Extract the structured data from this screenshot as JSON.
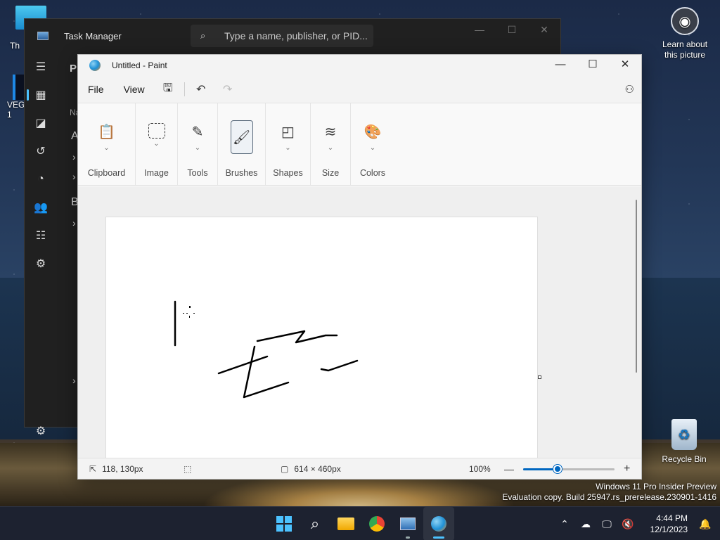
{
  "desktop": {
    "icons": [
      {
        "label": "Th"
      },
      {
        "label": "VEG\n1"
      },
      {
        "label": "Learn about\nthis picture"
      },
      {
        "label": "Recycle Bin"
      }
    ],
    "watermark": {
      "line1": "Windows 11 Pro Insider Preview",
      "line2": "Evaluation copy. Build 25947.rs_prerelease.230901-1416"
    }
  },
  "task_manager": {
    "title": "Task Manager",
    "search_placeholder": "Type a name, publisher, or PID...",
    "nav_icons": [
      "hamburger-icon",
      "processes-icon",
      "performance-icon",
      "history-icon",
      "startup-icon",
      "users-icon",
      "details-icon",
      "services-icon",
      "settings-icon"
    ],
    "partial_text": [
      "Pr",
      "Na",
      "A",
      "B"
    ]
  },
  "paint": {
    "title": "Untitled - Paint",
    "menu": {
      "file": "File",
      "view": "View"
    },
    "ribbon_groups": [
      {
        "label": "Clipboard",
        "icon": "clipboard-icon"
      },
      {
        "label": "Image",
        "icon": "select-icon"
      },
      {
        "label": "Tools",
        "icon": "tools-icon"
      },
      {
        "label": "Brushes",
        "icon": "brush-icon"
      },
      {
        "label": "Shapes",
        "icon": "shapes-icon"
      },
      {
        "label": "Size",
        "icon": "size-icon"
      },
      {
        "label": "Colors",
        "icon": "palette-icon"
      }
    ],
    "status": {
      "cursor_pos": "118, 130px",
      "canvas_size": "614 × 460px",
      "zoom": "100%",
      "zoom_level_fraction": 0.38
    }
  },
  "taskbar": {
    "apps": [
      "start",
      "search",
      "file-explorer",
      "chrome",
      "task-manager",
      "paint"
    ],
    "active_app": "paint",
    "time": "4:44 PM",
    "date": "12/1/2023"
  },
  "colors": {
    "accent": "#0067c0",
    "taskbar_accent": "#4cc2ff"
  }
}
